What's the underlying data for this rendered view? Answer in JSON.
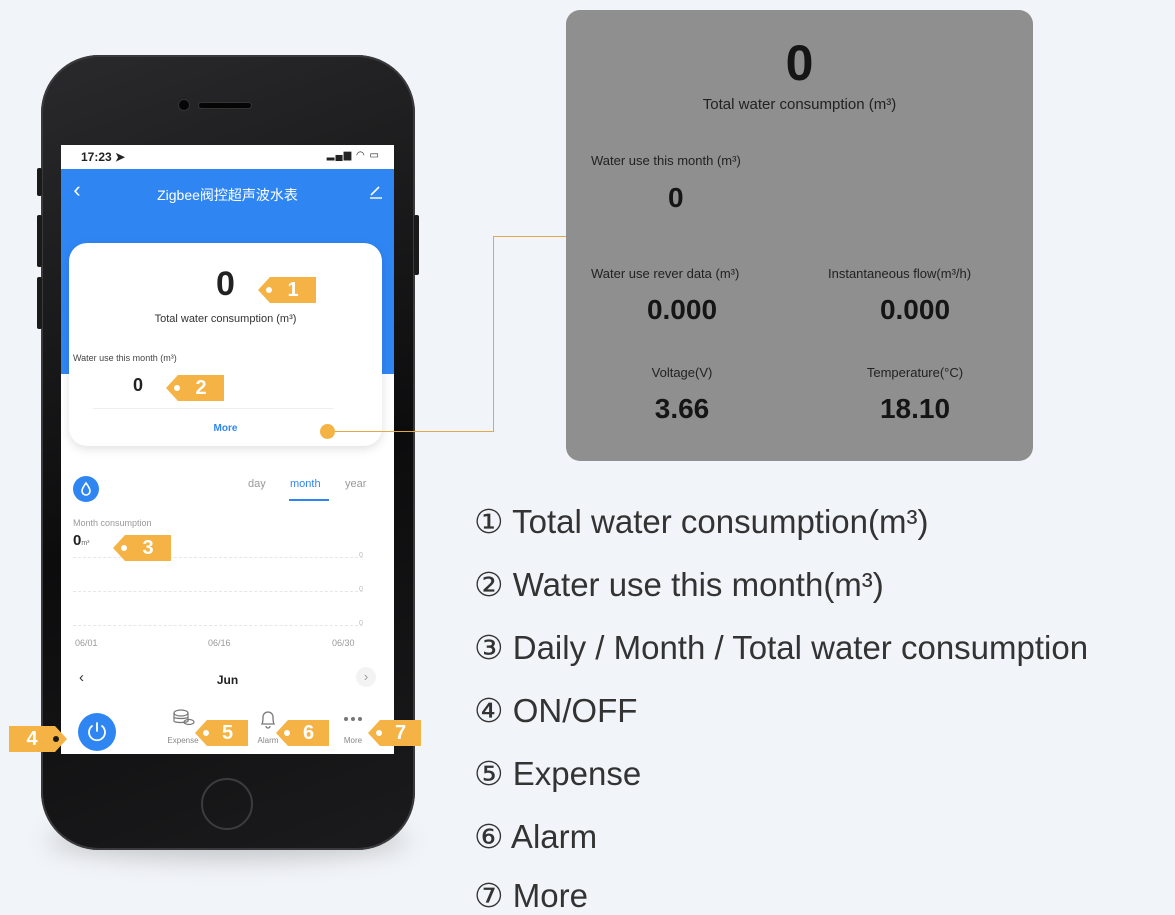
{
  "phone": {
    "status_time": "17:23 ➤",
    "status_icons": "▂▄▆ ◠ ▭",
    "app_title": "Zigbee阀控超声波水表",
    "total_value": "0",
    "total_label": "Total water consumption (m³)",
    "month_label": "Water use this month (m³)",
    "month_value": "0",
    "more_label": "More",
    "chart": {
      "segments": [
        "day",
        "month",
        "year"
      ],
      "active_segment": "month",
      "title": "Month consumption",
      "value": "0",
      "unit": "m³",
      "ylabels": [
        "0",
        "0",
        "0"
      ],
      "xticks": [
        "06/01",
        "06/16",
        "06/30"
      ],
      "month_nav": {
        "prev": "‹",
        "label": "Jun",
        "next": "›"
      }
    },
    "tabs": [
      {
        "label": "Expense",
        "icon": "coins-icon"
      },
      {
        "label": "Alarm",
        "icon": "bell-icon"
      },
      {
        "label": "More",
        "icon": "dots-icon"
      }
    ],
    "accent_color": "#2f86f3"
  },
  "callouts": [
    "1",
    "2",
    "3",
    "4",
    "5",
    "6",
    "7"
  ],
  "callout_color": "#f4b344",
  "panel": {
    "total_value": "0",
    "total_label": "Total water consumption (m³)",
    "month_label": "Water use this month (m³)",
    "month_value": "0",
    "reverse_label": "Water use rever data (m³)",
    "reverse_value": "0.000",
    "flow_label": "Instantaneous flow(m³/h)",
    "flow_value": "0.000",
    "voltage_label": "Voltage(V)",
    "voltage_value": "3.66",
    "temp_label": "Temperature(°C)",
    "temp_value": "18.10"
  },
  "legend": [
    "① Total water consumption(m³)",
    "② Water use this month(m³)",
    "③ Daily / Month / Total water consumption",
    "④ ON/OFF",
    "⑤ Expense",
    "⑥ Alarm",
    "⑦ More"
  ]
}
